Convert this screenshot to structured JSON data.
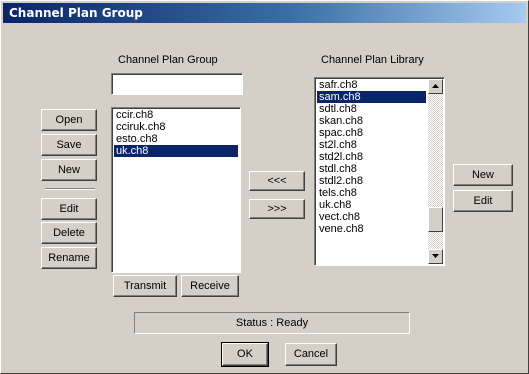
{
  "window": {
    "title": "Channel Plan Group"
  },
  "group": {
    "heading": "Channel Plan Group",
    "name_value": "",
    "items": [
      "ccir.ch8",
      "cciruk.ch8",
      "esto.ch8",
      "uk.ch8"
    ],
    "selected_index": 3
  },
  "library": {
    "heading": "Channel Plan Library",
    "items": [
      "safr.ch8",
      "sam.ch8",
      "sdtl.ch8",
      "skan.ch8",
      "spac.ch8",
      "st2l.ch8",
      "std2l.ch8",
      "stdl.ch8",
      "stdl2.ch8",
      "tels.ch8",
      "uk.ch8",
      "vect.ch8",
      "vene.ch8"
    ],
    "selected_index": 1
  },
  "left_buttons": {
    "open": "Open",
    "save": "Save",
    "new": "New",
    "edit": "Edit",
    "delete": "Delete",
    "rename": "Rename"
  },
  "transfer": {
    "add": "<<<",
    "remove": ">>>"
  },
  "right_buttons": {
    "new": "New",
    "edit": "Edit"
  },
  "bottom_buttons": {
    "transmit": "Transmit",
    "receive": "Receive"
  },
  "status": {
    "text": "Status : Ready"
  },
  "dialog": {
    "ok": "OK",
    "cancel": "Cancel"
  }
}
